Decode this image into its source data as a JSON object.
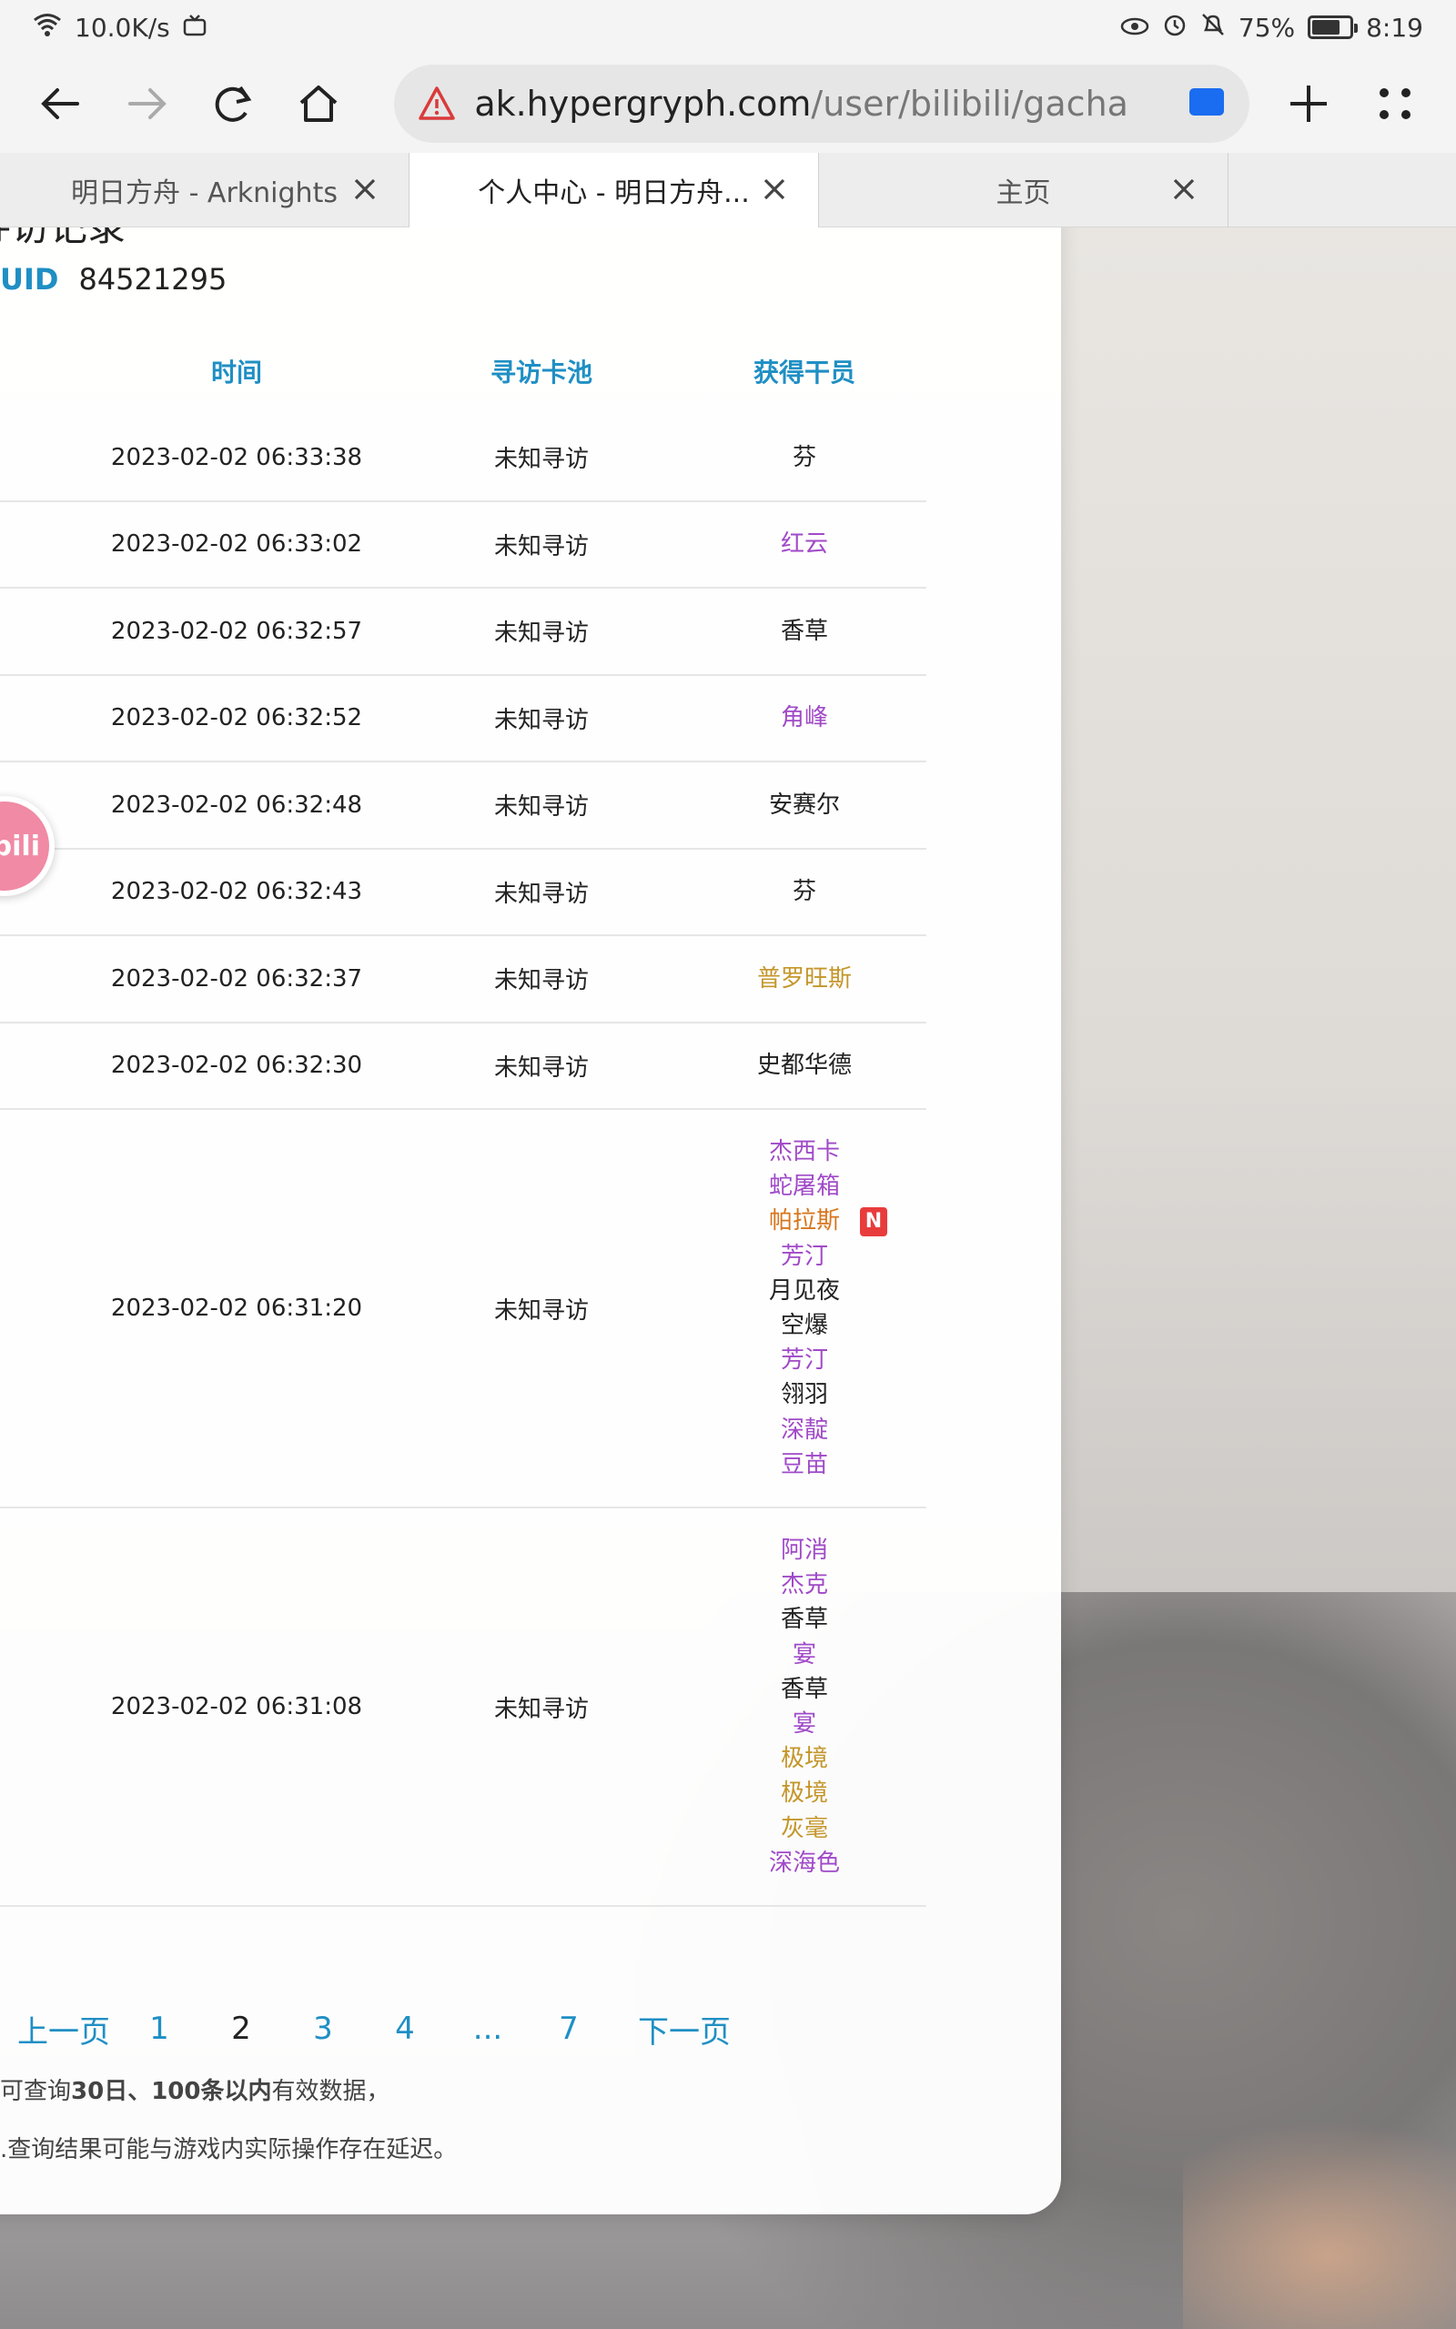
{
  "status": {
    "speed": "10.0K/s",
    "battery": "75%",
    "battery_level": 0.75,
    "time": "8:19"
  },
  "toolbar": {
    "url_host": "ak.hypergryph.com",
    "url_path": "/user/bilibili/gacha"
  },
  "tabs": [
    {
      "label": "明日方舟 - Arknights"
    },
    {
      "label": "个人中心 - 明日方舟..."
    },
    {
      "label": "主页"
    }
  ],
  "card": {
    "title": "寻访记录",
    "uid_label": "UID",
    "uid_value": "84521295"
  },
  "table": {
    "headers": {
      "time": "时间",
      "pool": "寻访卡池",
      "ops": "获得干员"
    },
    "rows": [
      {
        "time": "2023-02-02 06:33:38",
        "pool": "未知寻访",
        "ops": [
          {
            "name": "芬",
            "rarity": 3
          }
        ]
      },
      {
        "time": "2023-02-02 06:33:02",
        "pool": "未知寻访",
        "ops": [
          {
            "name": "红云",
            "rarity": 4
          }
        ]
      },
      {
        "time": "2023-02-02 06:32:57",
        "pool": "未知寻访",
        "ops": [
          {
            "name": "香草",
            "rarity": 3
          }
        ]
      },
      {
        "time": "2023-02-02 06:32:52",
        "pool": "未知寻访",
        "ops": [
          {
            "name": "角峰",
            "rarity": 4
          }
        ]
      },
      {
        "time": "2023-02-02 06:32:48",
        "pool": "未知寻访",
        "ops": [
          {
            "name": "安赛尔",
            "rarity": 3
          }
        ]
      },
      {
        "time": "2023-02-02 06:32:43",
        "pool": "未知寻访",
        "ops": [
          {
            "name": "芬",
            "rarity": 3
          }
        ]
      },
      {
        "time": "2023-02-02 06:32:37",
        "pool": "未知寻访",
        "ops": [
          {
            "name": "普罗旺斯",
            "rarity": 5
          }
        ]
      },
      {
        "time": "2023-02-02 06:32:30",
        "pool": "未知寻访",
        "ops": [
          {
            "name": "史都华德",
            "rarity": 3
          }
        ]
      },
      {
        "time": "2023-02-02 06:31:20",
        "pool": "未知寻访",
        "ops": [
          {
            "name": "杰西卡",
            "rarity": 4
          },
          {
            "name": "蛇屠箱",
            "rarity": 4
          },
          {
            "name": "帕拉斯",
            "rarity": 6,
            "badge": "N"
          },
          {
            "name": "芳汀",
            "rarity": 4
          },
          {
            "name": "月见夜",
            "rarity": 3
          },
          {
            "name": "空爆",
            "rarity": 3
          },
          {
            "name": "芳汀",
            "rarity": 4
          },
          {
            "name": "翎羽",
            "rarity": 3
          },
          {
            "name": "深靛",
            "rarity": 4
          },
          {
            "name": "豆苗",
            "rarity": 4
          }
        ]
      },
      {
        "time": "2023-02-02 06:31:08",
        "pool": "未知寻访",
        "ops": [
          {
            "name": "阿消",
            "rarity": 4
          },
          {
            "name": "杰克",
            "rarity": 4
          },
          {
            "name": "香草",
            "rarity": 3
          },
          {
            "name": "宴",
            "rarity": 4
          },
          {
            "name": "香草",
            "rarity": 3
          },
          {
            "name": "宴",
            "rarity": 4
          },
          {
            "name": "极境",
            "rarity": 5
          },
          {
            "name": "极境",
            "rarity": 5
          },
          {
            "name": "灰毫",
            "rarity": 5
          },
          {
            "name": "深海色",
            "rarity": 4
          }
        ]
      }
    ]
  },
  "pager": {
    "prev": "上一页",
    "pages": [
      "1",
      "2",
      "3",
      "4",
      "...",
      "7"
    ],
    "current": "2",
    "next": "下一页"
  },
  "notes": {
    "line1_prefix": "可查询",
    "line1_bold1": "30日、100条以内",
    "line1_suffix": "有效数据，",
    "line2": ".查询结果可能与游戏内实际操作存在延迟。"
  },
  "bili": {
    "label": "bili"
  },
  "colors": {
    "accent": "#1f8fc4",
    "rarity3": "#222222",
    "rarity4": "#a04ac8",
    "rarity5": "#c4962a",
    "rarity6": "#d8761e",
    "badge": "#e83c3c"
  }
}
